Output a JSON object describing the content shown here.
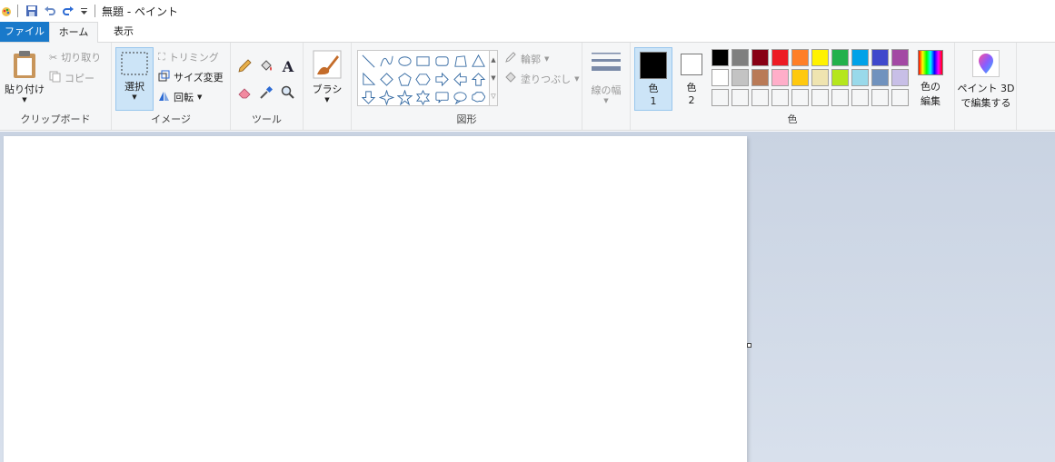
{
  "title": "無題 - ペイント",
  "qat": {
    "app_icon": "paint-app-icon",
    "save_icon": "save-icon",
    "undo_icon": "undo-icon",
    "redo_icon": "redo-icon",
    "customize_icon": "chevron-down-icon"
  },
  "tabs": {
    "file": "ファイル",
    "home": "ホーム",
    "view": "表示"
  },
  "clipboard": {
    "paste": "貼り付け",
    "cut": "切り取り",
    "copy": "コピー",
    "label": "クリップボード"
  },
  "image": {
    "select": "選択",
    "crop": "トリミング",
    "resize": "サイズ変更",
    "rotate": "回転",
    "label": "イメージ"
  },
  "tools": {
    "label": "ツール"
  },
  "brush": {
    "label": "ブラシ"
  },
  "shapes": {
    "outline": "輪郭",
    "fill": "塗りつぶし",
    "label": "図形"
  },
  "stroke": {
    "label": "線の幅"
  },
  "colors": {
    "color1_label": "色",
    "color1_num": "1",
    "color2_label": "色",
    "color2_num": "2",
    "edit_line1": "色の",
    "edit_line2": "編集",
    "label": "色",
    "color1": "#000000",
    "color2": "#ffffff",
    "palette_row1": [
      "#000000",
      "#7f7f7f",
      "#880015",
      "#ed1c24",
      "#ff7f27",
      "#fff200",
      "#22b14c",
      "#00a2e8",
      "#3f48cc",
      "#a349a4"
    ],
    "palette_row2": [
      "#ffffff",
      "#c3c3c3",
      "#b97a57",
      "#ffaec9",
      "#ffc90e",
      "#efe4b0",
      "#b5e61d",
      "#99d9ea",
      "#7092be",
      "#c8bfe7"
    ]
  },
  "paint3d": {
    "line1": "ペイント 3D",
    "line2": "で編集する"
  }
}
